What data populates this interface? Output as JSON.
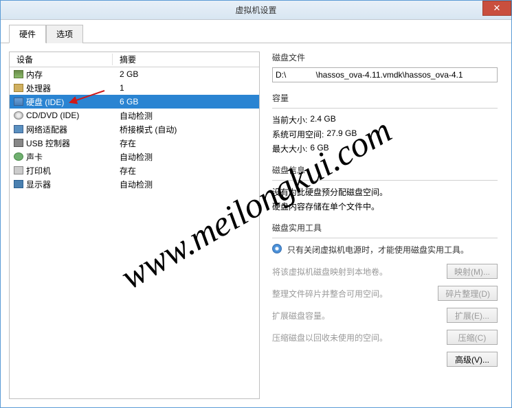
{
  "window": {
    "title": "虚拟机设置",
    "close_icon": "✕"
  },
  "tabs": {
    "hardware": "硬件",
    "options": "选项"
  },
  "columns": {
    "device": "设备",
    "summary": "摘要"
  },
  "devices": [
    {
      "icon": "ic-mem",
      "name": "内存",
      "summary": "2 GB"
    },
    {
      "icon": "ic-cpu",
      "name": "处理器",
      "summary": "1"
    },
    {
      "icon": "ic-disk",
      "name": "硬盘 (IDE)",
      "summary": "6 GB",
      "selected": true
    },
    {
      "icon": "ic-cd",
      "name": "CD/DVD (IDE)",
      "summary": "自动检测"
    },
    {
      "icon": "ic-net",
      "name": "网络适配器",
      "summary": "桥接模式 (自动)"
    },
    {
      "icon": "ic-usb",
      "name": "USB 控制器",
      "summary": "存在"
    },
    {
      "icon": "ic-snd",
      "name": "声卡",
      "summary": "自动检测"
    },
    {
      "icon": "ic-prn",
      "name": "打印机",
      "summary": "存在"
    },
    {
      "icon": "ic-mon",
      "name": "显示器",
      "summary": "自动检测"
    }
  ],
  "disk_file": {
    "title": "磁盘文件",
    "path": "D:\\             \\hassos_ova-4.11.vmdk\\hassos_ova-4.1"
  },
  "capacity": {
    "title": "容量",
    "current_label": "当前大小:",
    "current_value": "2.4 GB",
    "free_label": "系统可用空间:",
    "free_value": "27.9 GB",
    "max_label": "最大大小:",
    "max_value": "6 GB"
  },
  "disk_info": {
    "title": "磁盘信息",
    "line1": "没有为此硬盘预分配磁盘空间。",
    "line2": "硬盘内容存储在单个文件中。"
  },
  "utilities": {
    "title": "磁盘实用工具",
    "note": "只有关闭虚拟机电源时，才能使用磁盘实用工具。",
    "rows": [
      {
        "text": "将该虚拟机磁盘映射到本地卷。",
        "button": "映射(M)..."
      },
      {
        "text": "整理文件碎片并整合可用空间。",
        "button": "碎片整理(D)"
      },
      {
        "text": "扩展磁盘容量。",
        "button": "扩展(E)..."
      },
      {
        "text": "压缩磁盘以回收未使用的空间。",
        "button": "压缩(C)"
      }
    ],
    "advanced": "高级(V)..."
  },
  "watermark": "www.meilongkui.com"
}
